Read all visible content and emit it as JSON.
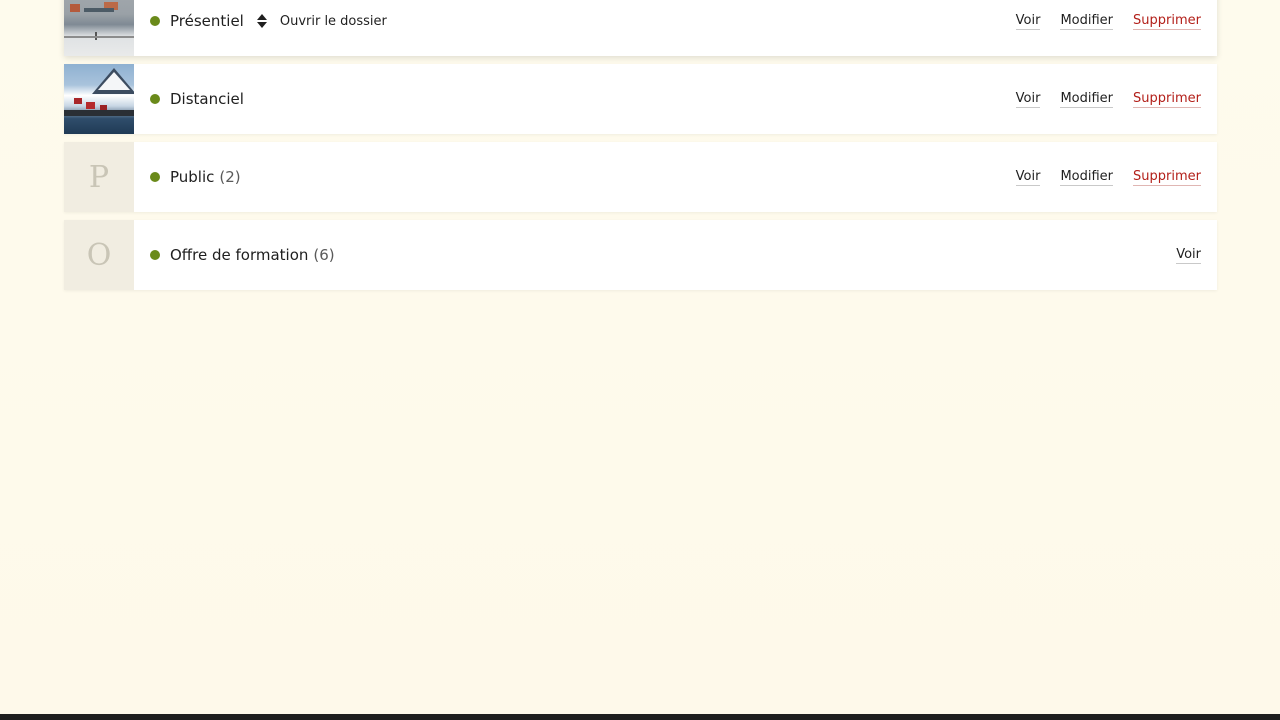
{
  "colors": {
    "status_dot": "#6a8a1a",
    "delete_link": "#b3201a",
    "page_background": "#fefaec"
  },
  "rows": [
    {
      "thumb_type": "photo-city",
      "title": "Présentiel",
      "count": "",
      "status_icon": "status-dot-icon",
      "sort_icon": "sort-handle-icon",
      "open_folder_label": "Ouvrir le dossier",
      "actions": {
        "view": "Voir",
        "edit": "Modifier",
        "delete": "Supprimer"
      }
    },
    {
      "thumb_type": "photo-island",
      "title": "Distanciel",
      "count": "",
      "status_icon": "status-dot-icon",
      "actions": {
        "view": "Voir",
        "edit": "Modifier",
        "delete": "Supprimer"
      }
    },
    {
      "thumb_type": "letter",
      "thumb_letter": "P",
      "title": "Public",
      "count": "(2)",
      "status_icon": "status-dot-icon",
      "actions": {
        "view": "Voir",
        "edit": "Modifier",
        "delete": "Supprimer"
      }
    },
    {
      "thumb_type": "letter",
      "thumb_letter": "O",
      "title": "Offre de formation",
      "count": "(6)",
      "status_icon": "status-dot-icon",
      "actions": {
        "view": "Voir"
      }
    }
  ]
}
